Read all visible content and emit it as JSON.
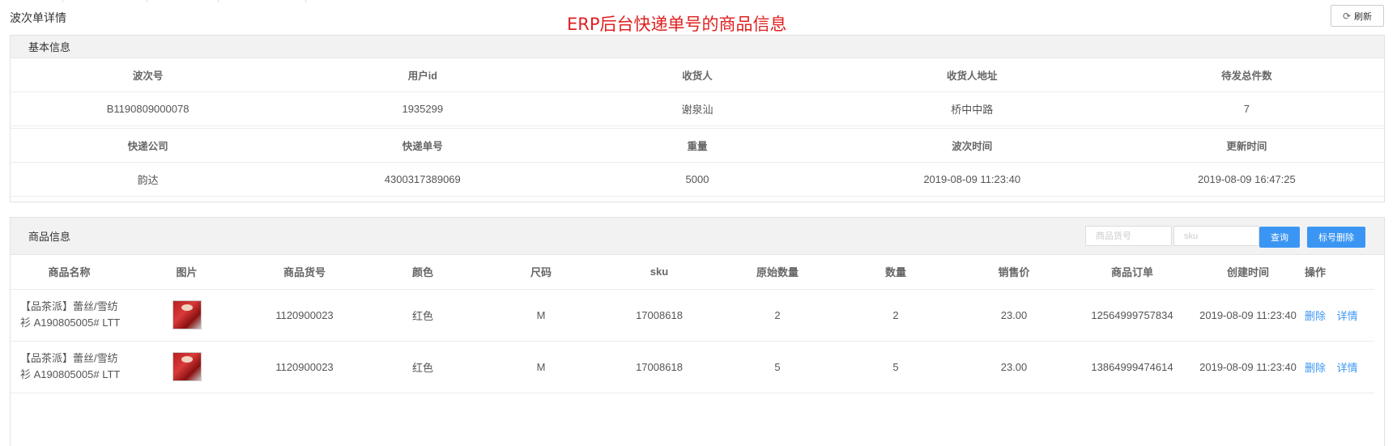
{
  "page": {
    "title": "波次单详情",
    "annotation": "ERP后台快递单号的商品信息",
    "refresh_label": "刷新"
  },
  "basic": {
    "title": "基本信息",
    "row1_labels": [
      "波次号",
      "用户id",
      "收货人",
      "收货人地址",
      "待发总件数"
    ],
    "row1_values": [
      "B1190809000078",
      "1935299",
      "谢泉汕",
      "桥中中路",
      "7"
    ],
    "row2_labels": [
      "快递公司",
      "快递单号",
      "重量",
      "波次时间",
      "更新时间"
    ],
    "row2_values": [
      "韵达",
      "4300317389069",
      "5000",
      "2019-08-09 11:23:40",
      "2019-08-09 16:47:25"
    ]
  },
  "goods": {
    "title": "商品信息",
    "search_code_placeholder": "商品货号",
    "search_sku_placeholder": "sku",
    "query_label": "查询",
    "mark_delete_label": "标号删除",
    "columns": [
      "商品名称",
      "图片",
      "商品货号",
      "颜色",
      "尺码",
      "sku",
      "原始数量",
      "数量",
      "销售价",
      "商品订单",
      "创建时间",
      "操作"
    ],
    "rows": [
      {
        "name_line1": "【品茶派】蕾丝/雪纺",
        "name_line2": "衫 A190805005# LTT",
        "code": "1120900023",
        "color": "红色",
        "size": "M",
        "sku": "17008618",
        "orig_qty": "2",
        "qty": "2",
        "price": "23.00",
        "order": "12564999757834",
        "created": "2019-08-09 11:23:40",
        "delete_label": "删除",
        "detail_label": "详情"
      },
      {
        "name_line1": "【品茶派】蕾丝/雪纺",
        "name_line2": "衫 A190805005# LTT",
        "code": "1120900023",
        "color": "红色",
        "size": "M",
        "sku": "17008618",
        "orig_qty": "5",
        "qty": "5",
        "price": "23.00",
        "order": "13864999474614",
        "created": "2019-08-09 11:23:40",
        "delete_label": "删除",
        "detail_label": "详情"
      }
    ]
  },
  "colors": {
    "accent": "#3b96f3",
    "annotation": "#e02020",
    "header_bg": "#f2f2f2"
  },
  "icons": {
    "refresh": "refresh-icon",
    "thumbnail": "product-thumbnail-icon"
  }
}
